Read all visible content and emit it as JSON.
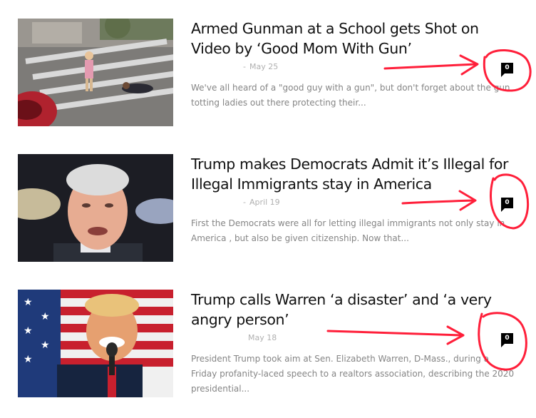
{
  "articles": [
    {
      "title_lines": [
        "Armed Gunman at a School gets Shot on",
        "Video by ‘Good Mom With Gun’"
      ],
      "date": "May 25",
      "excerpt_lines": [
        "We've all heard of a \"good guy with a gun\", but don't forget about the gun",
        "totting ladies out there protecting their..."
      ],
      "comment_count": "0",
      "thumbnail": "street-scene-image"
    },
    {
      "title_lines": [
        "Trump makes Democrats Admit it’s Illegal for",
        "Illegal Immigrants stay in America"
      ],
      "date": "April 19",
      "excerpt_lines": [
        "First the Democrats were all for letting illegal immigrants not only stay in",
        "America , but also be given citizenship. Now that..."
      ],
      "comment_count": "0",
      "thumbnail": "politician-portrait-image"
    },
    {
      "title_lines": [
        "Trump calls Warren ‘a disaster’ and ‘a very",
        "angry person’"
      ],
      "date": "May 18",
      "excerpt_lines": [
        "President Trump took aim at Sen. Elizabeth Warren, D-Mass., during a",
        "Friday profanity-laced speech to a realtors association, describing the 2020",
        "presidential..."
      ],
      "comment_count": "0",
      "thumbnail": "speaker-flag-image"
    }
  ],
  "meta_separator": "-",
  "colors": {
    "title": "#111111",
    "meta": "#b0b0b0",
    "excerpt": "#858585",
    "badge": "#000000",
    "annotation": "#ff1f3a"
  }
}
